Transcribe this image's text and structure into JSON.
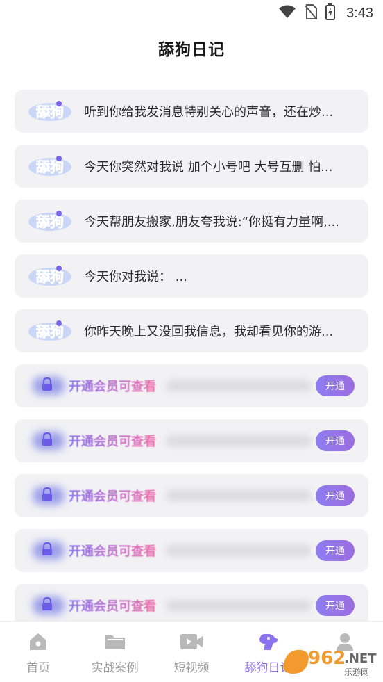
{
  "status_bar": {
    "time": "3:43"
  },
  "header": {
    "title": "舔狗日记"
  },
  "badge_text": "舔狗",
  "entries": [
    "听到你给我发消息特别关心的声音，还在炒...",
    "今天你突然对我说 加个小号吧 大号互删 怕...",
    "今天帮朋友搬家,朋友夸我说:“你挺有力量啊,...",
    "今天你对我说：  ...",
    "你昨天晚上又没回我信息，我却看见你的游..."
  ],
  "locked": {
    "label": "开通会员可查看",
    "button": "开通",
    "count": 5
  },
  "tabs": [
    {
      "label": "首页",
      "icon": "home-icon"
    },
    {
      "label": "实战案例",
      "icon": "folder-icon"
    },
    {
      "label": "短视频",
      "icon": "video-icon"
    },
    {
      "label": "舔狗日记",
      "icon": "dog-icon",
      "active": true
    },
    {
      "label": "",
      "icon": "profile-icon"
    }
  ],
  "watermark": {
    "brand": "962",
    "domain": ".NET",
    "sub": "乐游网"
  },
  "colors": {
    "accent": "#8b73ef",
    "pink": "#f06fa9",
    "card_bg": "#f2f2f4"
  }
}
